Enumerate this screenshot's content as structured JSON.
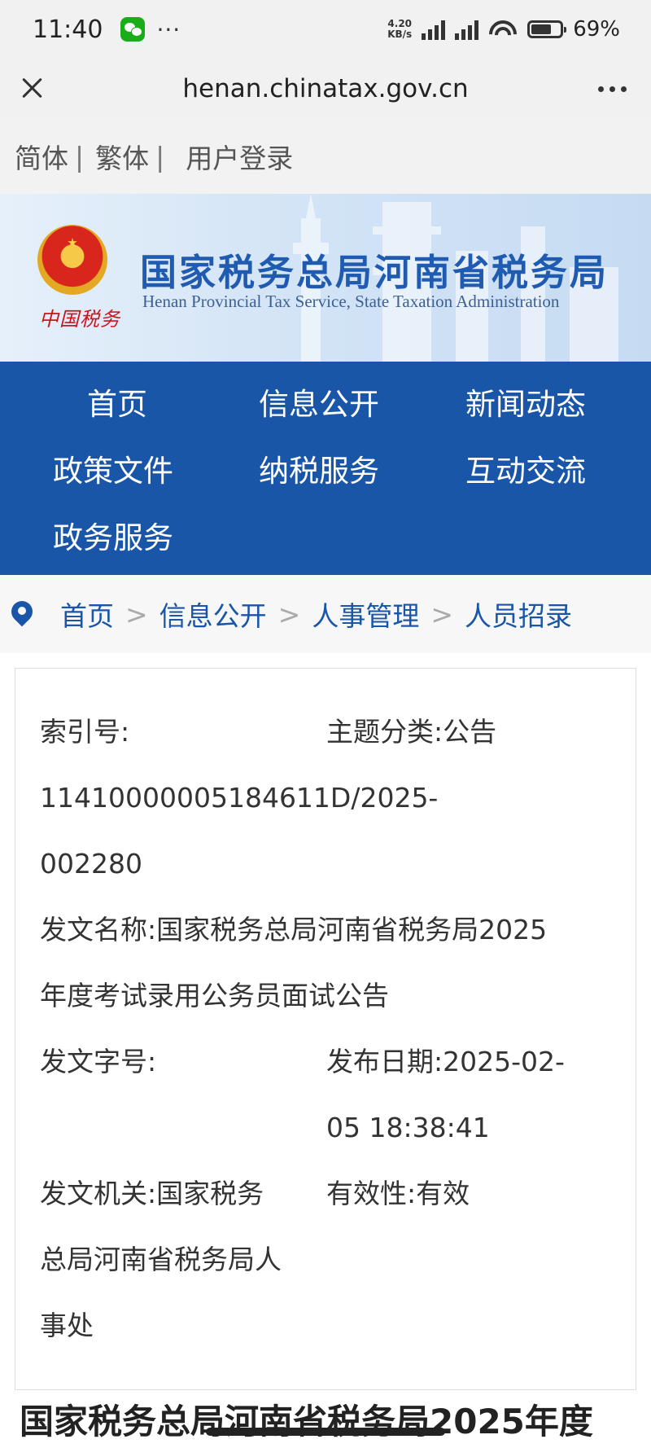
{
  "status_bar": {
    "time": "11:40",
    "dots": "···",
    "speed_value": "4.20",
    "speed_unit": "KB/s",
    "signal_hd": "HD",
    "battery_level": 0.69,
    "battery_text": "69%"
  },
  "browser": {
    "url": "henan.chinatax.gov.cn"
  },
  "lang_bar": {
    "simplified": "简体",
    "traditional": "繁体",
    "login": "用户登录",
    "separator": "|"
  },
  "banner": {
    "emblem_text": "中国税务",
    "title_cn": "国家税务总局河南省税务局",
    "title_en": "Henan Provincial Tax Service, State Taxation Administration"
  },
  "nav": {
    "items": [
      "首页",
      "信息公开",
      "新闻动态",
      "政策文件",
      "纳税服务",
      "互动交流",
      "政务服务"
    ]
  },
  "breadcrumb": {
    "items": [
      "首页",
      "信息公开",
      "人事管理",
      "人员招录"
    ],
    "separator": ">"
  },
  "meta": {
    "index_label": "索引号:",
    "index_value_line1": "11410000005184611D/2025-",
    "index_value_line2": "002280",
    "topic_label": "主题分类:",
    "topic_value": "公告",
    "doc_name_label": "发文名称:",
    "doc_name_line1": "国家税务总局河南省税务局2025",
    "doc_name_line2": "年度考试录用公务员面试公告",
    "doc_no_label": "发文字号:",
    "publish_label": "发布日期:",
    "publish_line1": "2025-02-",
    "publish_line2": "05 18:38:41",
    "issuer_label": "发文机关:",
    "issuer_line1": "国家税务",
    "issuer_line2": "总局河南省税务局人",
    "issuer_line3": "事处",
    "validity_label": "有效性:",
    "validity_value": "有效"
  },
  "article": {
    "title": "国家税务总局河南省税务局2025年度"
  }
}
